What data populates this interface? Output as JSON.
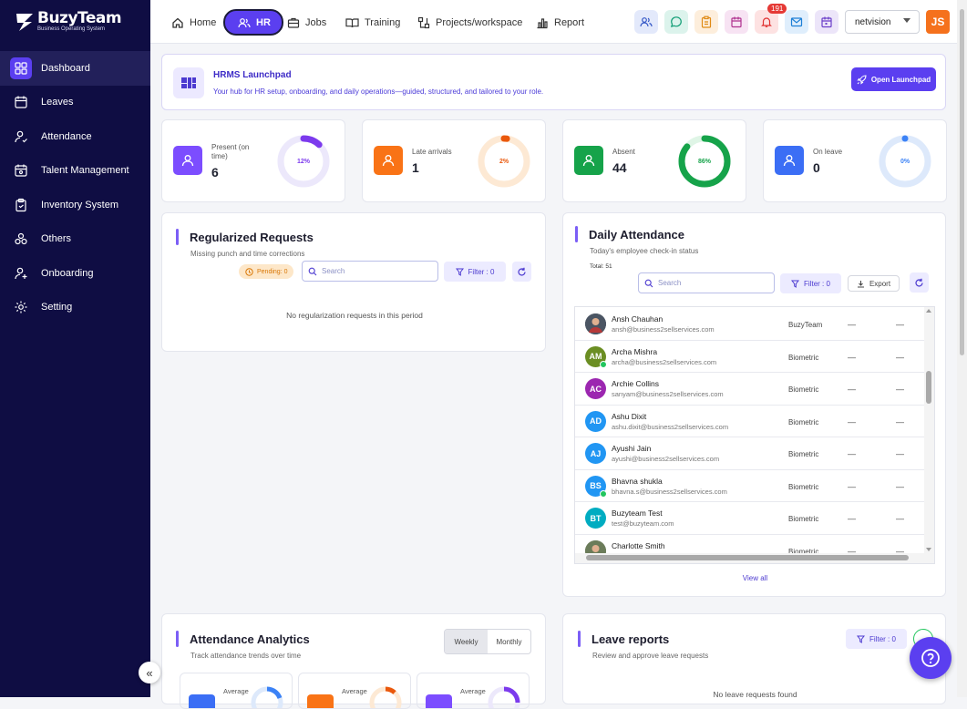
{
  "brand": {
    "name": "BuzyTeam",
    "tagline": "Business Operating System"
  },
  "sidebar": {
    "items": [
      {
        "label": "Dashboard",
        "icon": "dashboard-icon",
        "active": true
      },
      {
        "label": "Leaves",
        "icon": "calendar-icon"
      },
      {
        "label": "Attendance",
        "icon": "user-check-icon"
      },
      {
        "label": "Talent Management",
        "icon": "calendar-user-icon"
      },
      {
        "label": "Inventory System",
        "icon": "clipboard-icon"
      },
      {
        "label": "Others",
        "icon": "cluster-icon"
      },
      {
        "label": "Onboarding",
        "icon": "user-plus-icon"
      },
      {
        "label": "Setting",
        "icon": "gear-icon"
      }
    ],
    "collapse_icon": "«"
  },
  "topnav": {
    "tabs": [
      {
        "label": "Home",
        "icon": "home-icon"
      },
      {
        "label": "HR",
        "icon": "users-icon",
        "active": true
      },
      {
        "label": "Jobs",
        "icon": "briefcase-icon"
      },
      {
        "label": "Training",
        "icon": "book-icon"
      },
      {
        "label": "Projects/workspace",
        "icon": "workflow-icon"
      },
      {
        "label": "Report",
        "icon": "bar-chart-icon"
      }
    ],
    "notification_count": "191",
    "org_select": "netvision",
    "user_initials": "JS"
  },
  "launchpad": {
    "title": "HRMS Launchpad",
    "subtitle": "Your hub for HR setup, onboarding, and daily operations—guided, structured, and tailored to your role.",
    "button": "Open Launchpad"
  },
  "stats": [
    {
      "label": "Present (on time)",
      "value": "6",
      "percent_label": "12%",
      "percent": 12,
      "color": "#7c3aed",
      "track": "#ece8fb",
      "icon_bg": "#7c4dff"
    },
    {
      "label": "Late arrivals",
      "value": "1",
      "percent_label": "2%",
      "percent": 2,
      "color": "#ea580c",
      "track": "#fde9d4",
      "icon_bg": "#f97316"
    },
    {
      "label": "Absent",
      "value": "44",
      "percent_label": "86%",
      "percent": 86,
      "color": "#16a34a",
      "track": "#dff5e6",
      "icon_bg": "#16a34a"
    },
    {
      "label": "On leave",
      "value": "0",
      "percent_label": "0%",
      "percent": 0,
      "color": "#3b82f6",
      "track": "#dde9fb",
      "icon_bg": "#3b6ef5"
    }
  ],
  "regularized": {
    "title": "Regularized Requests",
    "subtitle": "Missing punch and time corrections",
    "pending": "Pending: 0",
    "search_placeholder": "Search",
    "filter": "Filter : 0",
    "empty": "No regularization requests in this period"
  },
  "daily_attendance": {
    "title": "Daily Attendance",
    "subtitle": "Today's employee check-in status",
    "total": "Total: 51",
    "search_placeholder": "Search",
    "filter": "Filter : 0",
    "export": "Export",
    "view_all": "View all",
    "rows": [
      {
        "name": "Ansh Chauhan",
        "email": "ansh@business2sellservices.com",
        "source": "BuzyTeam",
        "in": "—",
        "out": "—",
        "initials": "",
        "color": "#4b5563",
        "photo": true
      },
      {
        "name": "Archa Mishra",
        "email": "archa@business2sellservices.com",
        "source": "Biometric",
        "in": "—",
        "out": "—",
        "initials": "AM",
        "color": "#6b8e23",
        "online": true
      },
      {
        "name": "Archie Collins",
        "email": "sanyam@business2sellservices.com",
        "source": "Biometric",
        "in": "—",
        "out": "—",
        "initials": "AC",
        "color": "#9c27b0"
      },
      {
        "name": "Ashu Dixit",
        "email": "ashu.dixit@business2sellservices.com",
        "source": "Biometric",
        "in": "—",
        "out": "—",
        "initials": "AD",
        "color": "#2196f3"
      },
      {
        "name": "Ayushi Jain",
        "email": "ayushi@business2sellservices.com",
        "source": "Biometric",
        "in": "—",
        "out": "—",
        "initials": "AJ",
        "color": "#2196f3"
      },
      {
        "name": "Bhavna shukla",
        "email": "bhavna.s@business2sellservices.com",
        "source": "Biometric",
        "in": "—",
        "out": "—",
        "initials": "BS",
        "color": "#2196f3",
        "online": true
      },
      {
        "name": "Buzyteam Test",
        "email": "test@buzyteam.com",
        "source": "Biometric",
        "in": "—",
        "out": "—",
        "initials": "BT",
        "color": "#00acc1"
      },
      {
        "name": "Charlotte Smith",
        "email": "",
        "source": "Biometric",
        "in": "—",
        "out": "—",
        "initials": "",
        "color": "#6b7c5a",
        "photo": true
      }
    ]
  },
  "analytics": {
    "title": "Attendance Analytics",
    "subtitle": "Track attendance trends over time",
    "seg": [
      "Weekly",
      "Monthly"
    ],
    "mini_label": "Average"
  },
  "leave_reports": {
    "title": "Leave reports",
    "subtitle": "Review and approve leave requests",
    "filter": "Filter : 0",
    "empty": "No leave requests found"
  }
}
